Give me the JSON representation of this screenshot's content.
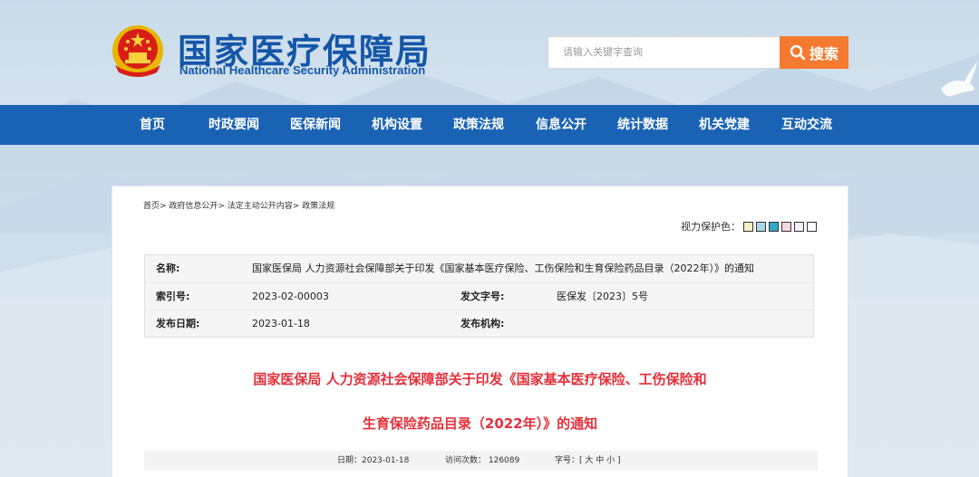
{
  "header": {
    "logo_cn": "国家医疗保障局",
    "logo_en": "National Healthcare Security Administration",
    "search_placeholder": "请输入关键字查询",
    "search_button": "搜索"
  },
  "nav": {
    "items": [
      "首页",
      "时政要闻",
      "医保新闻",
      "机构设置",
      "政策法规",
      "信息公开",
      "统计数据",
      "机关党建",
      "互动交流"
    ]
  },
  "breadcrumb": "首页> 政府信息公开> 法定主动公开内容> 政策法规",
  "vision": {
    "label": "视力保护色：",
    "colors": [
      "#f5f0c8",
      "#a8d8e8",
      "#2fa9c9",
      "#f5d8e0",
      "#f5eef8",
      "#ffffff"
    ]
  },
  "info": {
    "name_label": "名称:",
    "name_value": "国家医保局 人力资源社会保障部关于印发《国家基本医疗保险、工伤保险和生育保险药品目录（2022年）》的通知",
    "index_label": "索引号:",
    "index_value": "2023-02-00003",
    "doc_no_label": "发文字号:",
    "doc_no_value": "医保发〔2023〕5号",
    "date_label": "发布日期:",
    "date_value": "2023-01-18",
    "org_label": "发布机构:",
    "org_value": ""
  },
  "article": {
    "title_line1": "国家医保局 人力资源社会保障部关于印发《国家基本医疗保险、工伤保险和",
    "title_line2": "生育保险药品目录（2022年）》的通知"
  },
  "meta": {
    "date": "日期：2023-01-18",
    "visits": "访问次数：  126089",
    "font_size": "字号：[ 大 中 小 ]"
  }
}
